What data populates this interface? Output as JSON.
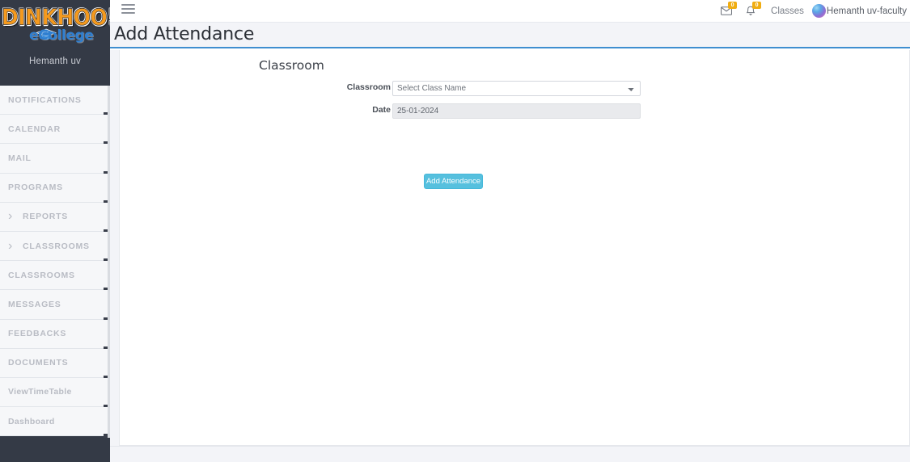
{
  "brand": {
    "logo_main": "DINKHOO!",
    "logo_sub": "eCollege",
    "logo_cap_icon": "graduation-cap-icon",
    "user_name": "Hemanth uv"
  },
  "sidebar": {
    "items": [
      {
        "label": "NOTIFICATIONS",
        "chevron": false
      },
      {
        "label": "CALENDAR",
        "chevron": false
      },
      {
        "label": "MAIL",
        "chevron": false
      },
      {
        "label": "PROGRAMS",
        "chevron": false
      },
      {
        "label": "REPORTS",
        "chevron": true
      },
      {
        "label": "CLASSROOMS",
        "chevron": true
      },
      {
        "label": "CLASSROOMS",
        "chevron": false
      },
      {
        "label": "MESSAGES",
        "chevron": false
      },
      {
        "label": "FEEDBACKS",
        "chevron": false
      },
      {
        "label": "DOCUMENTS",
        "chevron": false
      },
      {
        "label": "ViewTimeTable",
        "chevron": false
      },
      {
        "label": "Dashboard",
        "chevron": false
      }
    ],
    "chevron_glyph": "›"
  },
  "topbar": {
    "menu_toggle_icon": "hamburger-icon",
    "mail_icon": "envelope-icon",
    "mail_badge": "0",
    "notification_icon": "bell-icon",
    "notification_badge": "0",
    "classes_link": "Classes",
    "avatar_icon": "user-avatar",
    "username": "Hemanth uv-faculty",
    "badge_color": "#f0ad12"
  },
  "page": {
    "title": "Add Attendance",
    "accent_color": "#3f8ed0"
  },
  "form": {
    "section_title": "Classroom",
    "fields": [
      {
        "label": "Classroom",
        "type": "select",
        "value": "Select Class Name",
        "options": [
          "Select Class Name"
        ]
      },
      {
        "label": "Date",
        "type": "text",
        "value": "25-01-2024",
        "readonly": true
      }
    ],
    "submit_label": "Add Attendance",
    "submit_color": "#56c0de"
  }
}
